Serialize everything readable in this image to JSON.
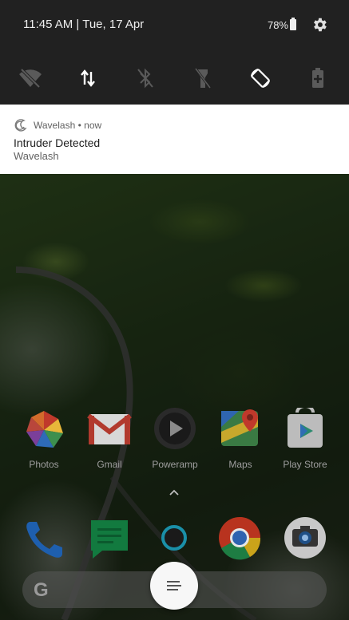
{
  "status_bar": {
    "time_date": "11:45 AM | Tue, 17 Apr",
    "battery": "78%"
  },
  "quick_settings": [
    {
      "name": "wifi-off"
    },
    {
      "name": "mobile-data"
    },
    {
      "name": "bluetooth-off"
    },
    {
      "name": "flashlight-off"
    },
    {
      "name": "auto-rotate"
    },
    {
      "name": "battery-saver"
    }
  ],
  "notification": {
    "app": "Wavelash",
    "time": "now",
    "title": "Intruder Detected",
    "text": "Wavelash"
  },
  "apps": [
    {
      "label": "Photos"
    },
    {
      "label": "Gmail"
    },
    {
      "label": "Poweramp"
    },
    {
      "label": "Maps"
    },
    {
      "label": "Play Store"
    }
  ],
  "dock": [
    "phone",
    "messages",
    "alexa",
    "chrome",
    "camera"
  ],
  "colors": {
    "shade": "#212121",
    "notification_bg": "#ffffff",
    "chrome_red": "#db4437",
    "chrome_yellow": "#f4c20d",
    "chrome_green": "#0f9d58",
    "phone_blue": "#1e88e5",
    "messages_green": "#0f9d58"
  }
}
